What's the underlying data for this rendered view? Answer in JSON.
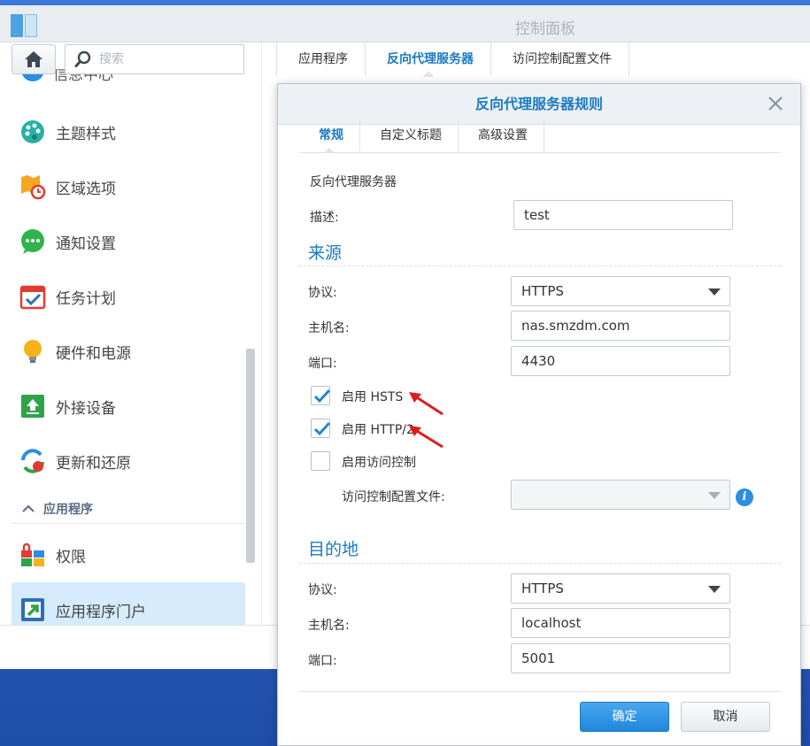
{
  "window": {
    "title": "控制面板"
  },
  "sidebar": {
    "search_placeholder": "搜索",
    "partial_item_label": "信息中心",
    "items": [
      {
        "label": "主题样式",
        "icon": "palette-icon"
      },
      {
        "label": "区域选项",
        "icon": "region-clock-icon"
      },
      {
        "label": "通知设置",
        "icon": "chat-bubble-icon"
      },
      {
        "label": "任务计划",
        "icon": "calendar-check-icon"
      },
      {
        "label": "硬件和电源",
        "icon": "lightbulb-icon"
      },
      {
        "label": "外接设备",
        "icon": "upload-box-icon"
      },
      {
        "label": "更新和还原",
        "icon": "refresh-icon"
      }
    ],
    "section_title": "应用程序",
    "section_items": [
      {
        "label": "权限",
        "icon": "lock-grid-icon"
      },
      {
        "label": "应用程序门户",
        "icon": "portal-arrow-icon"
      }
    ]
  },
  "main_tabs": [
    "应用程序",
    "反向代理服务器",
    "访问控制配置文件"
  ],
  "dialog": {
    "title": "反向代理服务器规则",
    "tabs": [
      "常规",
      "自定义标题",
      "高级设置"
    ],
    "group_label": "反向代理服务器",
    "description_label": "描述:",
    "description_value": "test",
    "source": {
      "heading": "来源",
      "protocol_label": "协议:",
      "protocol_value": "HTTPS",
      "hostname_label": "主机名:",
      "hostname_value": "nas.smzdm.com",
      "port_label": "端口:",
      "port_value": "4430",
      "enable_hsts_label": "启用 HSTS",
      "enable_hsts_checked": true,
      "enable_http2_label": "启用 HTTP/2",
      "enable_http2_checked": true,
      "enable_access_control_label": "启用访问控制",
      "enable_access_control_checked": false,
      "access_profile_label": "访问控制配置文件:",
      "access_profile_value": ""
    },
    "destination": {
      "heading": "目的地",
      "protocol_label": "协议:",
      "protocol_value": "HTTPS",
      "hostname_label": "主机名:",
      "hostname_value": "localhost",
      "port_label": "端口:",
      "port_value": "5001"
    },
    "ok_label": "确定",
    "cancel_label": "取消"
  },
  "colors": {
    "accent": "#1b7ac1",
    "annotation_arrow": "#e01b1b",
    "primary_button": "#2b8ee0"
  }
}
